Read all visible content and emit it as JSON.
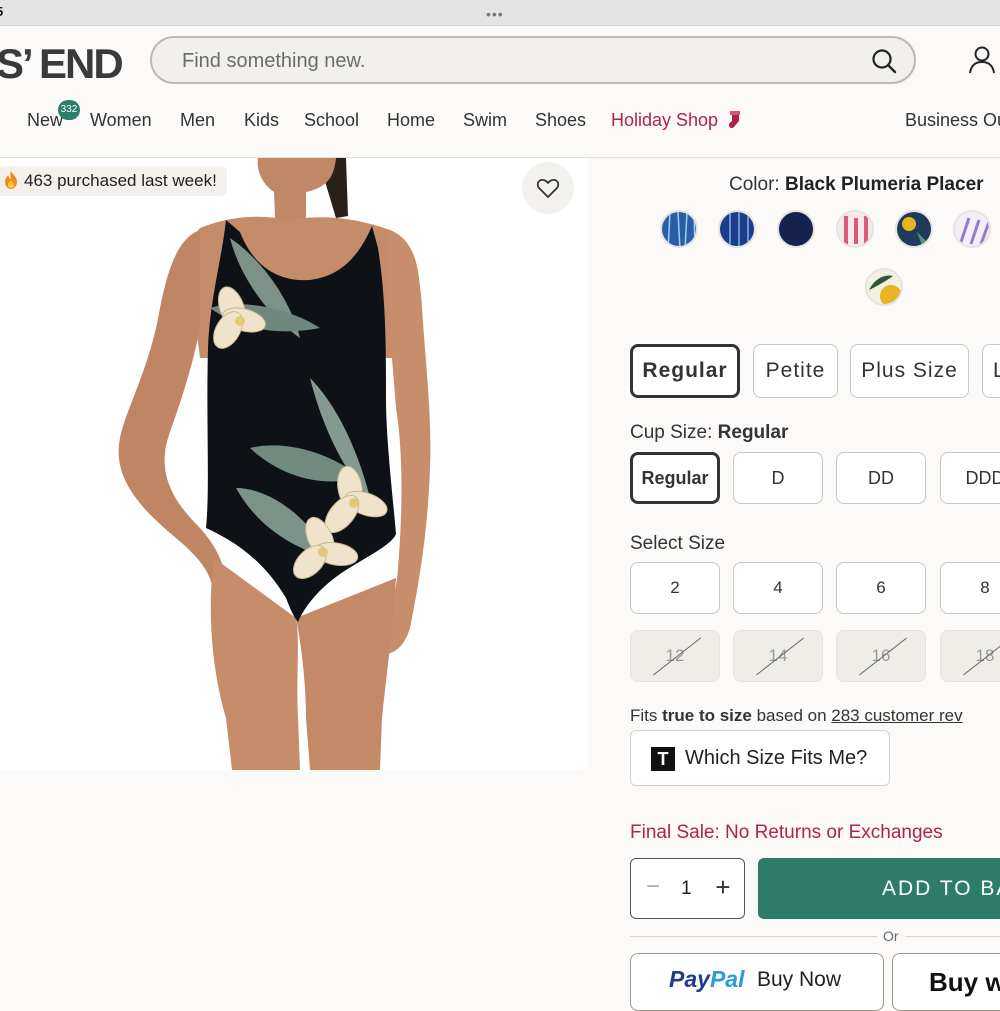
{
  "browser": {
    "time": "5",
    "menu_dots": "•••"
  },
  "header": {
    "logo": "S’ END",
    "search": {
      "placeholder": "Find something new."
    },
    "nav": [
      {
        "label": "New",
        "badge": "332"
      },
      {
        "label": "Women"
      },
      {
        "label": "Men"
      },
      {
        "label": "Kids"
      },
      {
        "label": "School"
      },
      {
        "label": "Home"
      },
      {
        "label": "Swim"
      },
      {
        "label": "Shoes"
      },
      {
        "label": "Holiday Shop"
      },
      {
        "label": "Business Ou"
      }
    ]
  },
  "product": {
    "purchase_banner": "463 purchased last week!",
    "image_alt": "Black floral one-piece swimsuit on model"
  },
  "colors": {
    "heading": "Color:",
    "selected": "Black Plumeria Placer",
    "swatches": [
      {
        "name": "blue-pattern",
        "color": "#2a5fa8"
      },
      {
        "name": "blue-stripe",
        "color": "#1a3f8a"
      },
      {
        "name": "navy",
        "color": "#17234f"
      },
      {
        "name": "pink-ikat",
        "color": "#d85a7a"
      },
      {
        "name": "navy-floral",
        "color": "#1f3a5a"
      },
      {
        "name": "purple-watercolor",
        "color": "#9a7ac8"
      },
      {
        "name": "yellow-floral",
        "color": "#e6b524"
      }
    ]
  },
  "fit": {
    "options": [
      "Regular",
      "Petite",
      "Plus Size",
      "L"
    ],
    "selected": "Regular"
  },
  "cup": {
    "label": "Cup Size:",
    "selected": "Regular",
    "options": [
      "Regular",
      "D",
      "DD",
      "DDD"
    ]
  },
  "size": {
    "label": "Select Size",
    "available": [
      "2",
      "4",
      "6",
      "8"
    ],
    "unavailable": [
      "12",
      "14",
      "16",
      "18"
    ]
  },
  "fit_info": {
    "prefix": "Fits ",
    "emphasis": "true to size",
    "middle": " based on ",
    "link": "283 customer rev"
  },
  "which_size": {
    "icon": "T",
    "label": "Which Size Fits Me?"
  },
  "final_sale": "Final Sale: No Returns or Exchanges",
  "quantity": {
    "minus": "−",
    "value": "1",
    "plus": "+"
  },
  "add_to_bag": "ADD TO BA",
  "or": "Or",
  "paypal": {
    "pay": "Pay",
    "pal": "Pal",
    "label": "Buy Now"
  },
  "buy_other": "Buy w",
  "accent": {
    "green": "#2e7d6a",
    "sale_red": "#b0234a"
  }
}
